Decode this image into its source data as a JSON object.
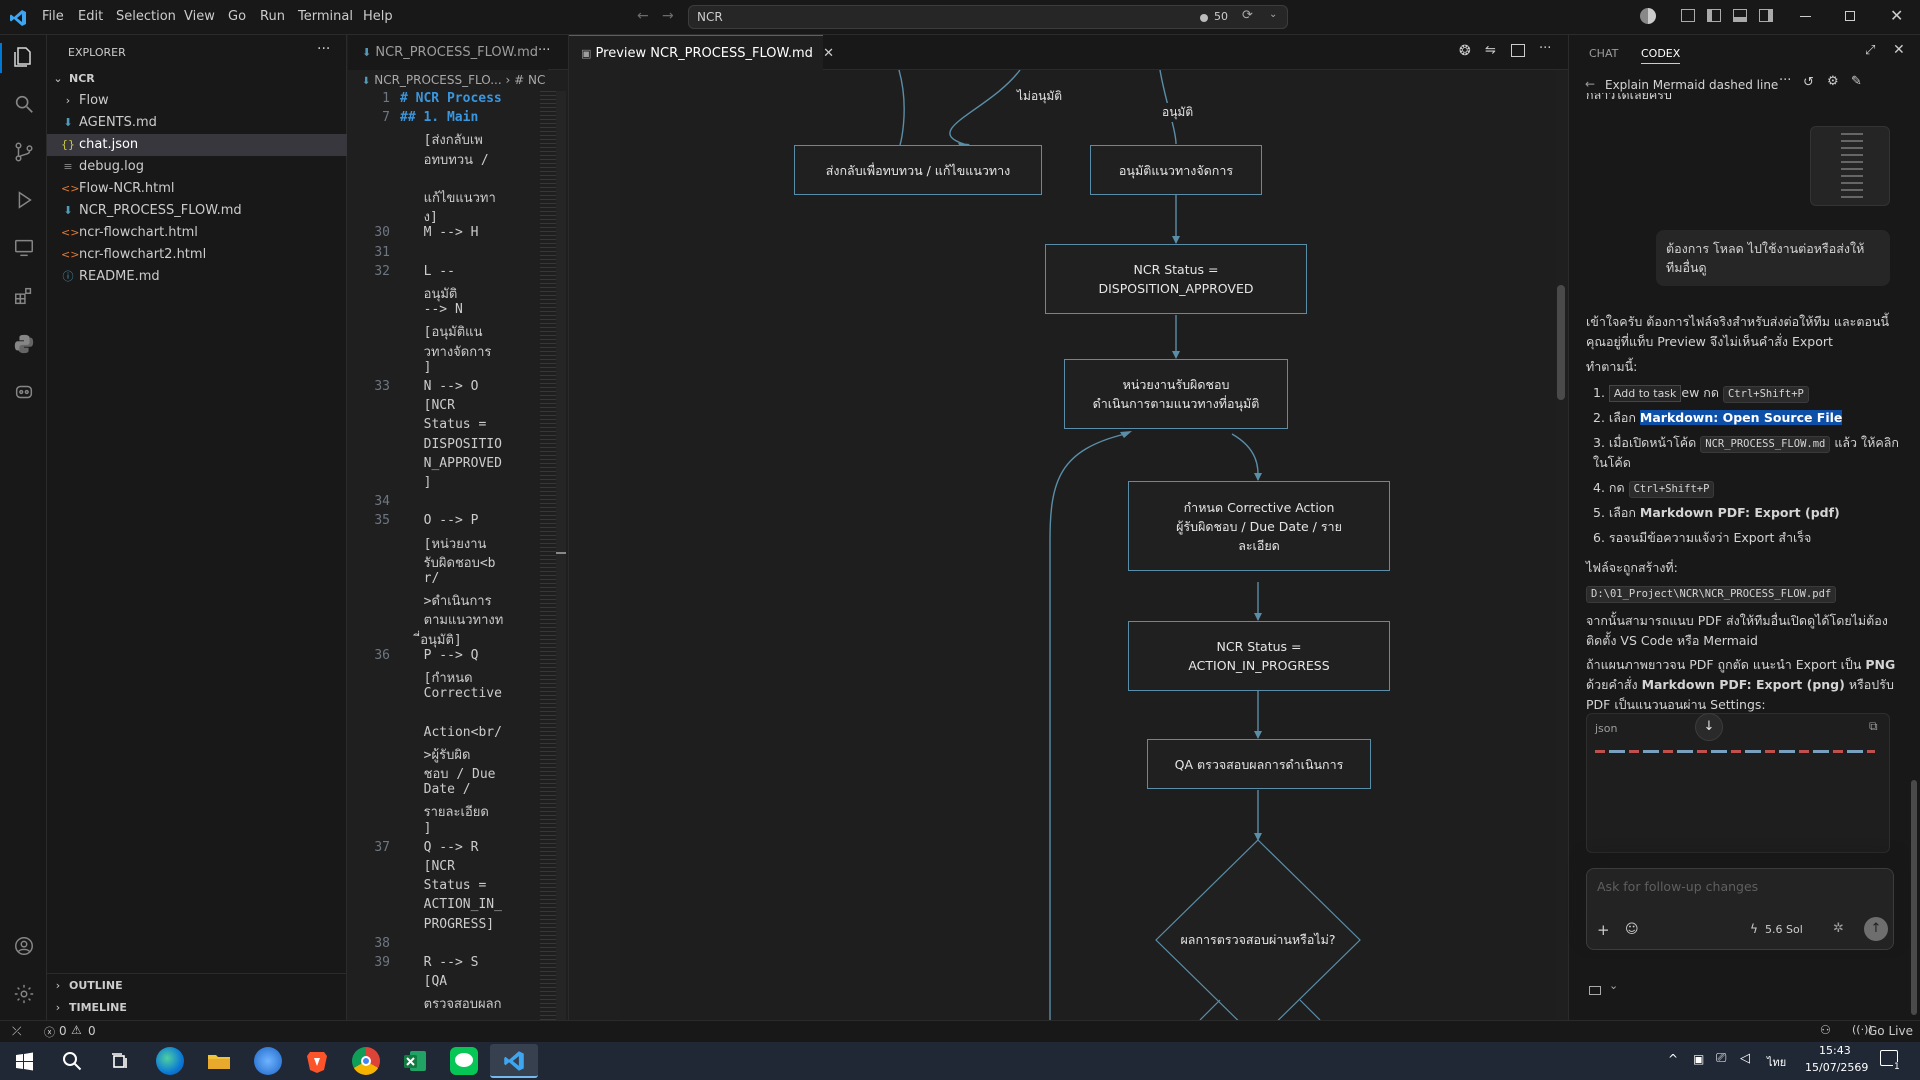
{
  "titlebar": {
    "menus": [
      "File",
      "Edit",
      "Selection",
      "View",
      "Go",
      "Run",
      "Terminal",
      "Help"
    ],
    "search": "NCR",
    "counter": "50"
  },
  "explorer": {
    "header": "EXPLORER",
    "root": "NCR",
    "items": [
      {
        "name": "Flow",
        "kind": "folder"
      },
      {
        "name": "AGENTS.md",
        "kind": "md"
      },
      {
        "name": "chat.json",
        "kind": "json"
      },
      {
        "name": "debug.log",
        "kind": "log"
      },
      {
        "name": "Flow-NCR.html",
        "kind": "html"
      },
      {
        "name": "NCR_PROCESS_FLOW.md",
        "kind": "md"
      },
      {
        "name": "ncr-flowchart.html",
        "kind": "html"
      },
      {
        "name": "ncr-flowchart2.html",
        "kind": "html"
      },
      {
        "name": "README.md",
        "kind": "info"
      }
    ],
    "outline": "OUTLINE",
    "timeline": "TIMELINE"
  },
  "editor": {
    "tab": "NCR_PROCESS_FLOW.md",
    "breadcrumb": "NCR_PROCESS_FLO...",
    "breadcrumb2": "# NC",
    "lines": [
      {
        "n": "1",
        "t": "# NCR Process"
      },
      {
        "n": "7",
        "t": "## 1. Main"
      },
      {
        "n": "",
        "t": "  [ส่งกลับเพ"
      },
      {
        "n": "",
        "t": "  อทบทวน /"
      },
      {
        "n": "",
        "t": ""
      },
      {
        "n": "",
        "t": "  แก้ไขแนวทา"
      },
      {
        "n": "",
        "t": "  ง]"
      },
      {
        "n": "30",
        "t": "  M --> H"
      },
      {
        "n": "31",
        "t": ""
      },
      {
        "n": "32",
        "t": "  L --"
      },
      {
        "n": "",
        "t": "  อนุมัติ"
      },
      {
        "n": "",
        "t": "  --> N"
      },
      {
        "n": "",
        "t": "  [อนุมัติแน"
      },
      {
        "n": "",
        "t": "  วทางจัดการ"
      },
      {
        "n": "",
        "t": "  ]"
      },
      {
        "n": "33",
        "t": "  N --> O"
      },
      {
        "n": "",
        "t": "  [NCR"
      },
      {
        "n": "",
        "t": "  Status ="
      },
      {
        "n": "",
        "t": "  DISPOSITIO"
      },
      {
        "n": "",
        "t": "  N_APPROVED"
      },
      {
        "n": "",
        "t": "  ]"
      },
      {
        "n": "34",
        "t": ""
      },
      {
        "n": "35",
        "t": "  O --> P"
      },
      {
        "n": "",
        "t": "  [หน่วยงาน"
      },
      {
        "n": "",
        "t": "  รับผิดชอบ<b"
      },
      {
        "n": "",
        "t": "  r/"
      },
      {
        "n": "",
        "t": "  >ดำเนินการ"
      },
      {
        "n": "",
        "t": "  ตามแนวทางท"
      },
      {
        "n": "",
        "t": "  ี่อนุมัติ]"
      },
      {
        "n": "36",
        "t": "  P --> Q"
      },
      {
        "n": "",
        "t": "  [กำหนด"
      },
      {
        "n": "",
        "t": "  Corrective"
      },
      {
        "n": "",
        "t": ""
      },
      {
        "n": "",
        "t": "  Action<br/"
      },
      {
        "n": "",
        "t": "  >ผู้รับผิด"
      },
      {
        "n": "",
        "t": "  ชอบ / Due"
      },
      {
        "n": "",
        "t": "  Date /"
      },
      {
        "n": "",
        "t": "  รายละเอียด"
      },
      {
        "n": "",
        "t": "  ]"
      },
      {
        "n": "37",
        "t": "  Q --> R"
      },
      {
        "n": "",
        "t": "  [NCR"
      },
      {
        "n": "",
        "t": "  Status ="
      },
      {
        "n": "",
        "t": "  ACTION_IN_"
      },
      {
        "n": "",
        "t": "  PROGRESS]"
      },
      {
        "n": "38",
        "t": ""
      },
      {
        "n": "39",
        "t": "  R --> S"
      },
      {
        "n": "",
        "t": "  [QA"
      },
      {
        "n": "",
        "t": "  ตรวจสอบผลก"
      }
    ]
  },
  "preview": {
    "tab": "Preview NCR_PROCESS_FLOW.md",
    "edge_reject": "ไม่อนุมัติ",
    "edge_approve": "อนุมัติ",
    "n_return": "ส่งกลับเพื่อทบทวน / แก้ไขแนวทาง",
    "n_approve": "อนุมัติแนวทางจัดการ",
    "n_status1_a": "NCR Status =",
    "n_status1_b": "DISPOSITION_APPROVED",
    "n_exec_a": "หน่วยงานรับผิดชอบ",
    "n_exec_b": "ดำเนินการตามแนวทางที่อนุมัติ",
    "n_ca_a": "กำหนด Corrective Action",
    "n_ca_b": "ผู้รับผิดชอบ / Due Date / ราย",
    "n_ca_c": "ละเอียด",
    "n_status2_a": "NCR Status =",
    "n_status2_b": "ACTION_IN_PROGRESS",
    "n_qa": "QA ตรวจสอบผลการดำเนินการ",
    "n_decision": "ผลการตรวจสอบผ่านหรือไม่?"
  },
  "chat": {
    "tab_chat": "CHAT",
    "tab_codex": "CODEX",
    "thread": "Explain Mermaid dashed line",
    "cut_top": "กล่าวได้เลยครับ",
    "user_msg": "ต้องการ โหลด ไปใช้งานต่อหรือส่งให้ทีมอื่นดู",
    "p1": "เข้าใจครับ ต้องการไฟล์จริงสำหรับส่งต่อให้ทีม และตอนนี้คุณอยู่ที่แท็บ Preview จึงไม่เห็นคำสั่ง Export",
    "do_this": "ทำตามนี้:",
    "s1_num": "1.",
    "s1_tip": "Add to task",
    "s1_rest": "ew กด",
    "s1_kbd": "Ctrl+Shift+P",
    "s2_num": "2.",
    "s2_pre": "เลือก",
    "s2_hl": "Markdown: Open Source File",
    "s3_num": "3.",
    "s3_pre": "เมื่อเปิดหน้าโค้ด",
    "s3_kbd": "NCR_PROCESS_FLOW.md",
    "s3_post": "แล้ว ให้คลิกในโค้ด",
    "s4_num": "4.",
    "s4_pre": "กด",
    "s4_kbd": "Ctrl+Shift+P",
    "s5_num": "5.",
    "s5_pre": "เลือก",
    "s5_b": "Markdown PDF: Export (pdf)",
    "s6_num": "6.",
    "s6": "รอจนมีข้อความแจ้งว่า Export สำเร็จ",
    "file_created": "ไฟล์จะถูกสร้างที่:",
    "path": "D:\\01_Project\\NCR\\NCR_PROCESS_FLOW.pdf",
    "p2": "จากนั้นสามารถแนบ PDF ส่งให้ทีมอื่นเปิดดูได้โดยไม่ต้องติดตั้ง VS Code หรือ Mermaid",
    "p3_a": "ถ้าแผนภาพยาวจน PDF ถูกตัด แนะนำ Export เป็น",
    "p3_b": "PNG",
    "p3_c": "ด้วยคำสั่ง",
    "p3_d": "Markdown PDF: Export (png)",
    "p3_e": "หรือปรับ PDF เป็นแนวนอนผ่าน Settings:",
    "code_lang": "json",
    "input_placeholder": "Ask for follow-up changes",
    "model": "5.6 Sol"
  },
  "status": {
    "errors": "0",
    "warnings": "0",
    "golive": "Go Live"
  },
  "taskbar": {
    "time": "15:43",
    "date": "15/07/2569",
    "lang": "ไทย",
    "notif": "1"
  }
}
